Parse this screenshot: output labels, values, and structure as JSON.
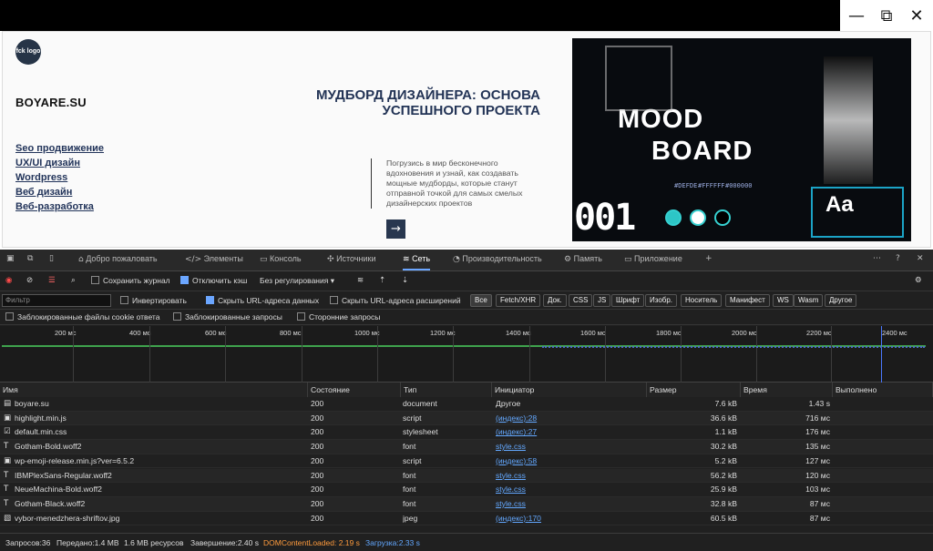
{
  "window": {
    "minimize_icon": "—",
    "restore_icon": "⧉",
    "close_icon": "✕"
  },
  "site": {
    "logo_text": "fck logo",
    "brand": "BOYARE.SU",
    "links": [
      "Seo продвижение",
      "UX/UI дизайн",
      "Wordpress",
      "Веб дизайн",
      "Веб-разработка"
    ],
    "headline": "МУДБОРД ДИЗАЙНЕРА: ОСНОВА УСПЕШНОГО ПРОЕКТА",
    "intro": "Погрузись в мир бесконечного вдохновения и узнай, как создавать мощные мудборды, которые станут отправной точкой для самых смелых дизайнерских проектов",
    "arrow": "→",
    "banner": {
      "mood": "MOOD",
      "board": "BOARD",
      "number": "001",
      "aa": "Aa",
      "tags": [
        "#DEFDE",
        "#FFFFFF",
        "#000000"
      ]
    }
  },
  "devtools": {
    "tabs": [
      "Добро пожаловать",
      "Элементы",
      "Консоль",
      "Источники",
      "Сеть",
      "Производительность",
      "Память",
      "Приложение"
    ],
    "toolbar": {
      "preserve_log": "Сохранить журнал",
      "disable_cache": "Отключить кэш",
      "throttling": "Без регулирования"
    },
    "filter": {
      "placeholder": "Фильтр",
      "invert": "Инвертировать",
      "hide_data_urls": "Скрыть URL-адреса данных",
      "hide_ext_urls": "Скрыть URL-адреса расширений"
    },
    "types": [
      "Все",
      "Fetch/XHR",
      "Док.",
      "CSS",
      "JS",
      "Шрифт",
      "Изобр.",
      "Носитель",
      "Манифест",
      "WS",
      "Wasm",
      "Другое"
    ],
    "blocked": {
      "cookies": "Заблокированные файлы cookie ответа",
      "requests": "Заблокированные запросы",
      "third_party": "Сторонние запросы"
    },
    "timeline_ticks": [
      "200 мс",
      "400 мс",
      "600 мс",
      "800 мс",
      "1000 мс",
      "1200 мс",
      "1400 мс",
      "1600 мс",
      "1800 мс",
      "2000 мс",
      "2200 мс",
      "2400 мс"
    ],
    "columns": [
      "Имя",
      "Состояние",
      "Тип",
      "Инициатор",
      "Размер",
      "Время",
      "Выполнено"
    ],
    "rows": [
      {
        "icon": "▤",
        "name": "boyare.su",
        "status": "200",
        "type": "document",
        "initiator": "Другое",
        "size": "7.6 kB",
        "time": "1.43 s"
      },
      {
        "icon": "▣",
        "name": "highlight.min.js",
        "status": "200",
        "type": "script",
        "initiator": "(индекс):28",
        "size": "36.6 kB",
        "time": "716 мс"
      },
      {
        "icon": "☑",
        "name": "default.min.css",
        "status": "200",
        "type": "stylesheet",
        "initiator": "(индекс):27",
        "size": "1.1 kB",
        "time": "176 мс"
      },
      {
        "icon": "T",
        "name": "Gotham-Bold.woff2",
        "status": "200",
        "type": "font",
        "initiator": "style.css",
        "size": "30.2 kB",
        "time": "135 мс"
      },
      {
        "icon": "▣",
        "name": "wp-emoji-release.min.js?ver=6.5.2",
        "status": "200",
        "type": "script",
        "initiator": "(индекс):58",
        "size": "5.2 kB",
        "time": "127 мс"
      },
      {
        "icon": "T",
        "name": "IBMPlexSans-Regular.woff2",
        "status": "200",
        "type": "font",
        "initiator": "style.css",
        "size": "56.2 kB",
        "time": "120 мс"
      },
      {
        "icon": "T",
        "name": "NeueMachina-Bold.woff2",
        "status": "200",
        "type": "font",
        "initiator": "style.css",
        "size": "25.9 kB",
        "time": "103 мс"
      },
      {
        "icon": "T",
        "name": "Gotham-Black.woff2",
        "status": "200",
        "type": "font",
        "initiator": "style.css",
        "size": "32.8 kB",
        "time": "87 мс"
      },
      {
        "icon": "▧",
        "name": "vybor-menedzhera-shriftov.jpg",
        "status": "200",
        "type": "jpeg",
        "initiator": "(индекс):170",
        "size": "60.5 kB",
        "time": "87 мс"
      }
    ],
    "status": {
      "requests": "Запросов:36",
      "transferred": "Передано:1.4 MB",
      "resources": "1.6 MB ресурсов",
      "finish": "Завершение:2.40 s",
      "dom": "DOMContentLoaded: 2.19 s",
      "load": "Загрузка:2.33 s"
    }
  }
}
